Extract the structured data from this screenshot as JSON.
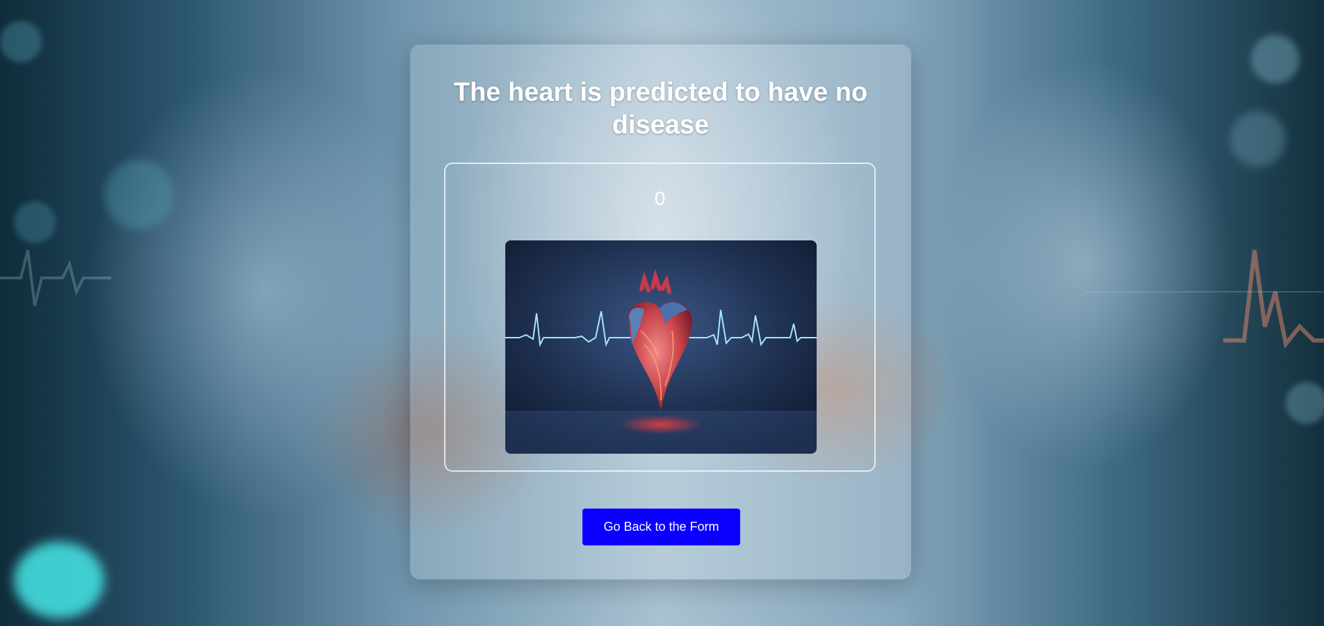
{
  "result": {
    "title": "The heart is predicted to have no disease",
    "prediction_value": "0",
    "image_description": "heart-with-ecg-line"
  },
  "actions": {
    "back_button_label": "Go Back to the Form"
  },
  "colors": {
    "button_background": "#0b00ff",
    "text": "#ffffff"
  }
}
